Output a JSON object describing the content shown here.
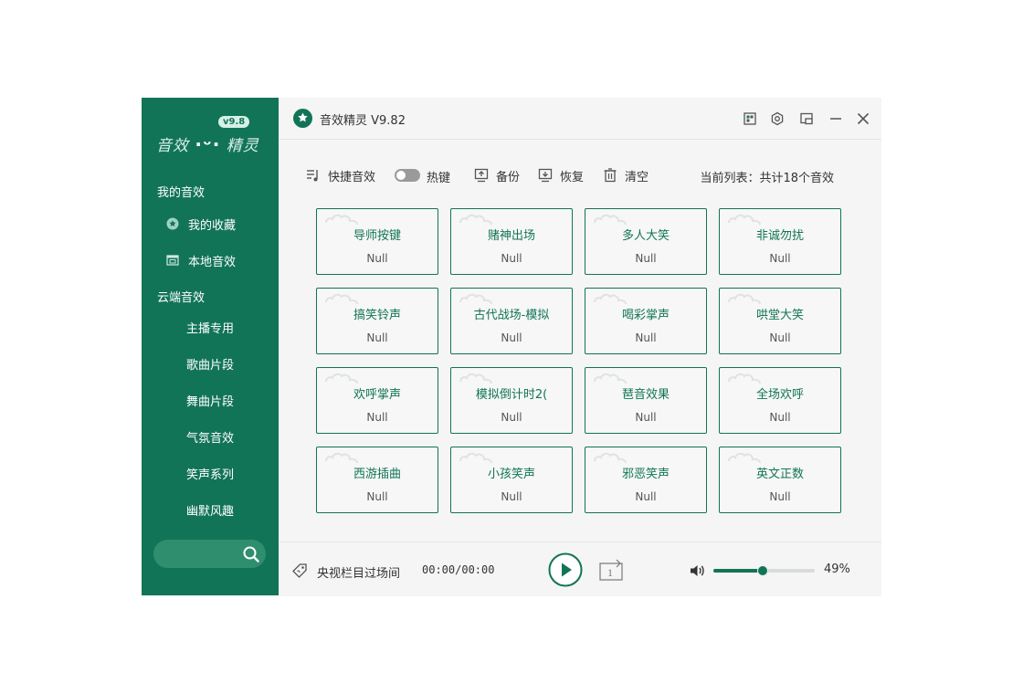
{
  "colors": {
    "brand": "#127457",
    "sidebar_bg": "#127457",
    "card_border": "#127457",
    "text": "#333333"
  },
  "sidebar": {
    "logo_left": "音效",
    "logo_right": "精灵",
    "logo_badge": "v9.8",
    "my_sounds_heading": "我的音效",
    "favorites": {
      "label": "我的收藏",
      "icon": "star-badge-icon"
    },
    "local": {
      "label": "本地音效",
      "icon": "image-folder-icon"
    },
    "cloud_heading": "云端音效",
    "cloud_items": [
      "主播专用",
      "歌曲片段",
      "舞曲片段",
      "气氛音效",
      "笑声系列",
      "幽默风趣"
    ],
    "search_placeholder": "",
    "search_icon": "search-icon"
  },
  "titlebar": {
    "title": "音效精灵 V9.82",
    "buttons": [
      "skin-icon",
      "settings-icon",
      "mini-mode-icon",
      "minimize-icon",
      "close-icon"
    ]
  },
  "toolbar": {
    "quick_label": "快捷音效",
    "hotkey_label": "热键",
    "hotkey_enabled": false,
    "backup_label": "备份",
    "restore_label": "恢复",
    "clear_label": "清空",
    "list_status": "当前列表：共计18个音效"
  },
  "cards": [
    {
      "name": "导师按键",
      "hotkey": "Null"
    },
    {
      "name": "赌神出场",
      "hotkey": "Null"
    },
    {
      "name": "多人大笑",
      "hotkey": "Null"
    },
    {
      "name": "非诚勿扰",
      "hotkey": "Null"
    },
    {
      "name": "搞笑铃声",
      "hotkey": "Null"
    },
    {
      "name": "古代战场-模拟",
      "hotkey": "Null"
    },
    {
      "name": "喝彩掌声",
      "hotkey": "Null"
    },
    {
      "name": "哄堂大笑",
      "hotkey": "Null"
    },
    {
      "name": "欢呼掌声",
      "hotkey": "Null"
    },
    {
      "name": "模拟倒计时2(",
      "hotkey": "Null"
    },
    {
      "name": "琶音效果",
      "hotkey": "Null"
    },
    {
      "name": "全场欢呼",
      "hotkey": "Null"
    },
    {
      "name": "西游插曲",
      "hotkey": "Null"
    },
    {
      "name": "小孩笑声",
      "hotkey": "Null"
    },
    {
      "name": "邪恶笑声",
      "hotkey": "Null"
    },
    {
      "name": "英文正数",
      "hotkey": "Null"
    }
  ],
  "player": {
    "now_playing": "央视栏目过场间",
    "time": "00:00/00:00",
    "loop_count": "1",
    "volume_percent": 49,
    "volume_text": "49%"
  }
}
